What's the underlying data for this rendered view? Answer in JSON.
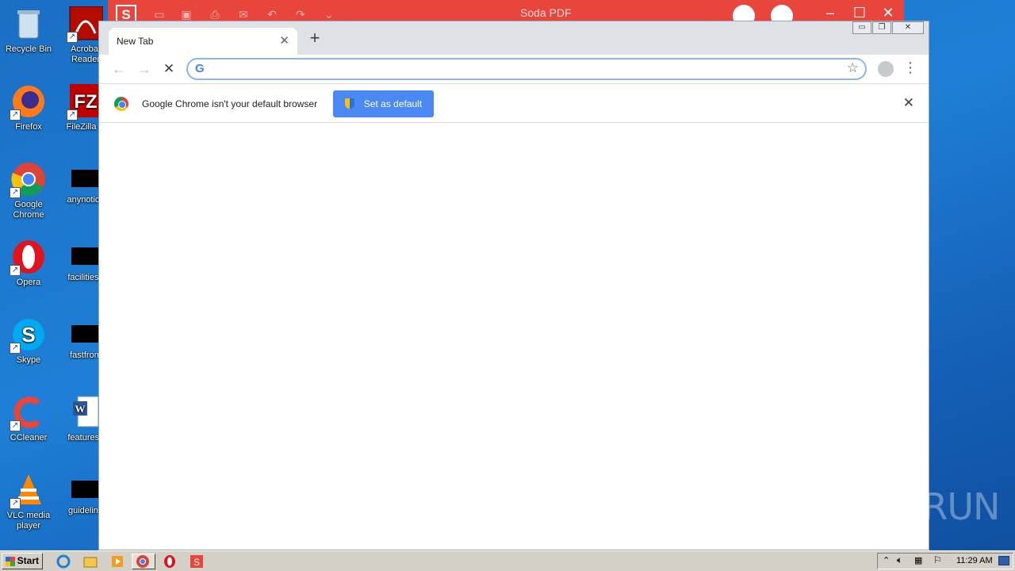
{
  "desktop": {
    "icons_col1": [
      {
        "label": "Recycle Bin"
      },
      {
        "label": "Firefox"
      },
      {
        "label": "Google Chrome"
      },
      {
        "label": "Opera"
      },
      {
        "label": "Skype"
      },
      {
        "label": "CCleaner"
      },
      {
        "label": "VLC media player"
      }
    ],
    "icons_col2": [
      {
        "label": "Acrobat Reader"
      },
      {
        "label": "FileZilla C"
      },
      {
        "label": "anynotice"
      },
      {
        "label": "facilitiesa"
      },
      {
        "label": "fastfrom"
      },
      {
        "label": "featuress"
      },
      {
        "label": "guideline"
      }
    ]
  },
  "soda_pdf": {
    "title": "Soda PDF",
    "logo": "S",
    "accent": "#e8453c"
  },
  "chrome": {
    "tab": {
      "label": "New Tab",
      "close": "✕"
    },
    "new_tab": "+",
    "window_controls": {
      "minimize": "▭",
      "restore": "❐",
      "close": "✕"
    },
    "nav": {
      "back": "←",
      "forward": "→",
      "stop": "✕"
    },
    "omnibox": {
      "value": "",
      "g_logo": "G",
      "star": "☆"
    },
    "menu": "⋮",
    "infobar": {
      "message": "Google Chrome isn't your default browser",
      "button": "Set as default",
      "close": "✕"
    }
  },
  "watermark": "ANY▷RUN",
  "taskbar": {
    "start": "Start",
    "clock": "11:29 AM"
  }
}
